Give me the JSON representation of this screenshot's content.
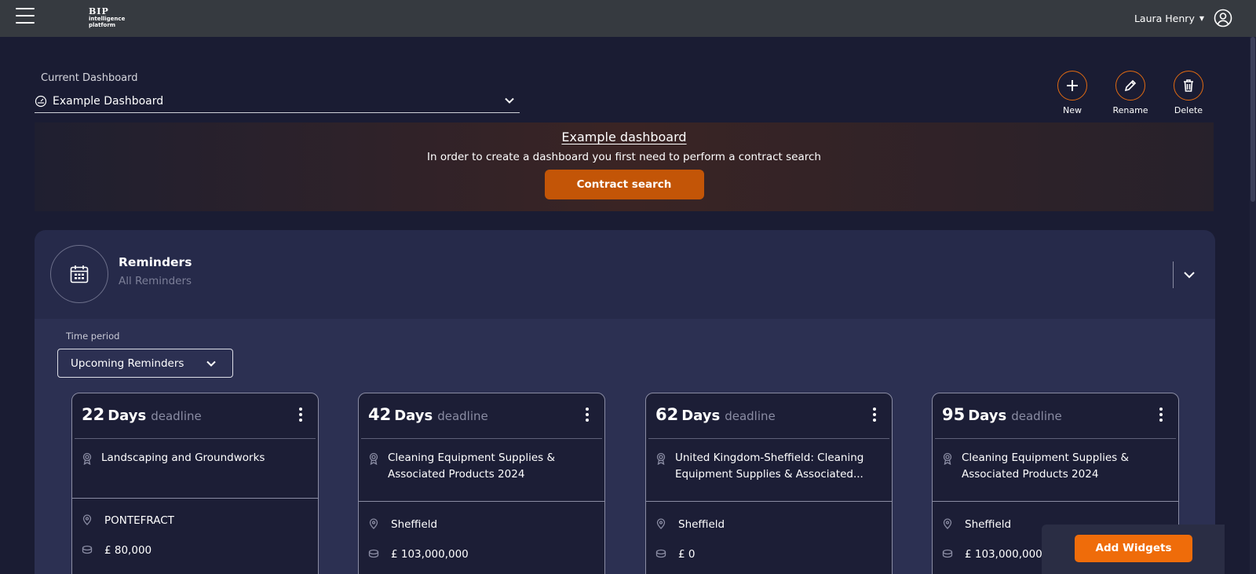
{
  "header": {
    "brand_top": "BIP",
    "brand_bottom_1": "intelligence",
    "brand_bottom_2": "platform",
    "user_name": "Laura Henry",
    "icons": [
      "menu-icon",
      "user-circle-icon",
      "caret-down-icon"
    ]
  },
  "dashboard": {
    "label": "Current Dashboard",
    "selected": "Example Dashboard",
    "actions": {
      "new": "New",
      "rename": "Rename",
      "delete": "Delete"
    },
    "accent": "#e06a12"
  },
  "banner": {
    "title": "Example dashboard",
    "description": "In order to create a dashboard you first need to perform a contract search",
    "button": "Contract search"
  },
  "reminders": {
    "title": "Reminders",
    "subtitle": "All Reminders",
    "time_period_label": "Time period",
    "time_period_value": "Upcoming Reminders",
    "cards": [
      {
        "number": "22",
        "unit": "Days",
        "suffix": "deadline",
        "tender": "Landscaping and Groundworks",
        "location": "PONTEFRACT",
        "value": "£ 80,000"
      },
      {
        "number": "42",
        "unit": "Days",
        "suffix": "deadline",
        "tender": "Cleaning Equipment Supplies & Associated Products 2024",
        "location": "Sheffield",
        "value": "£ 103,000,000"
      },
      {
        "number": "62",
        "unit": "Days",
        "suffix": "deadline",
        "tender": "United Kingdom-Sheffield: Cleaning Equipment Supplies & Associated...",
        "location": "Sheffield",
        "value": "£ 0"
      },
      {
        "number": "95",
        "unit": "Days",
        "suffix": "deadline",
        "tender": "Cleaning Equipment Supplies & Associated Products 2024",
        "location": "Sheffield",
        "value": "£ 103,000,000"
      }
    ]
  },
  "widgets": {
    "add_label": "Add Widgets",
    "color": "#ef6c0a"
  }
}
